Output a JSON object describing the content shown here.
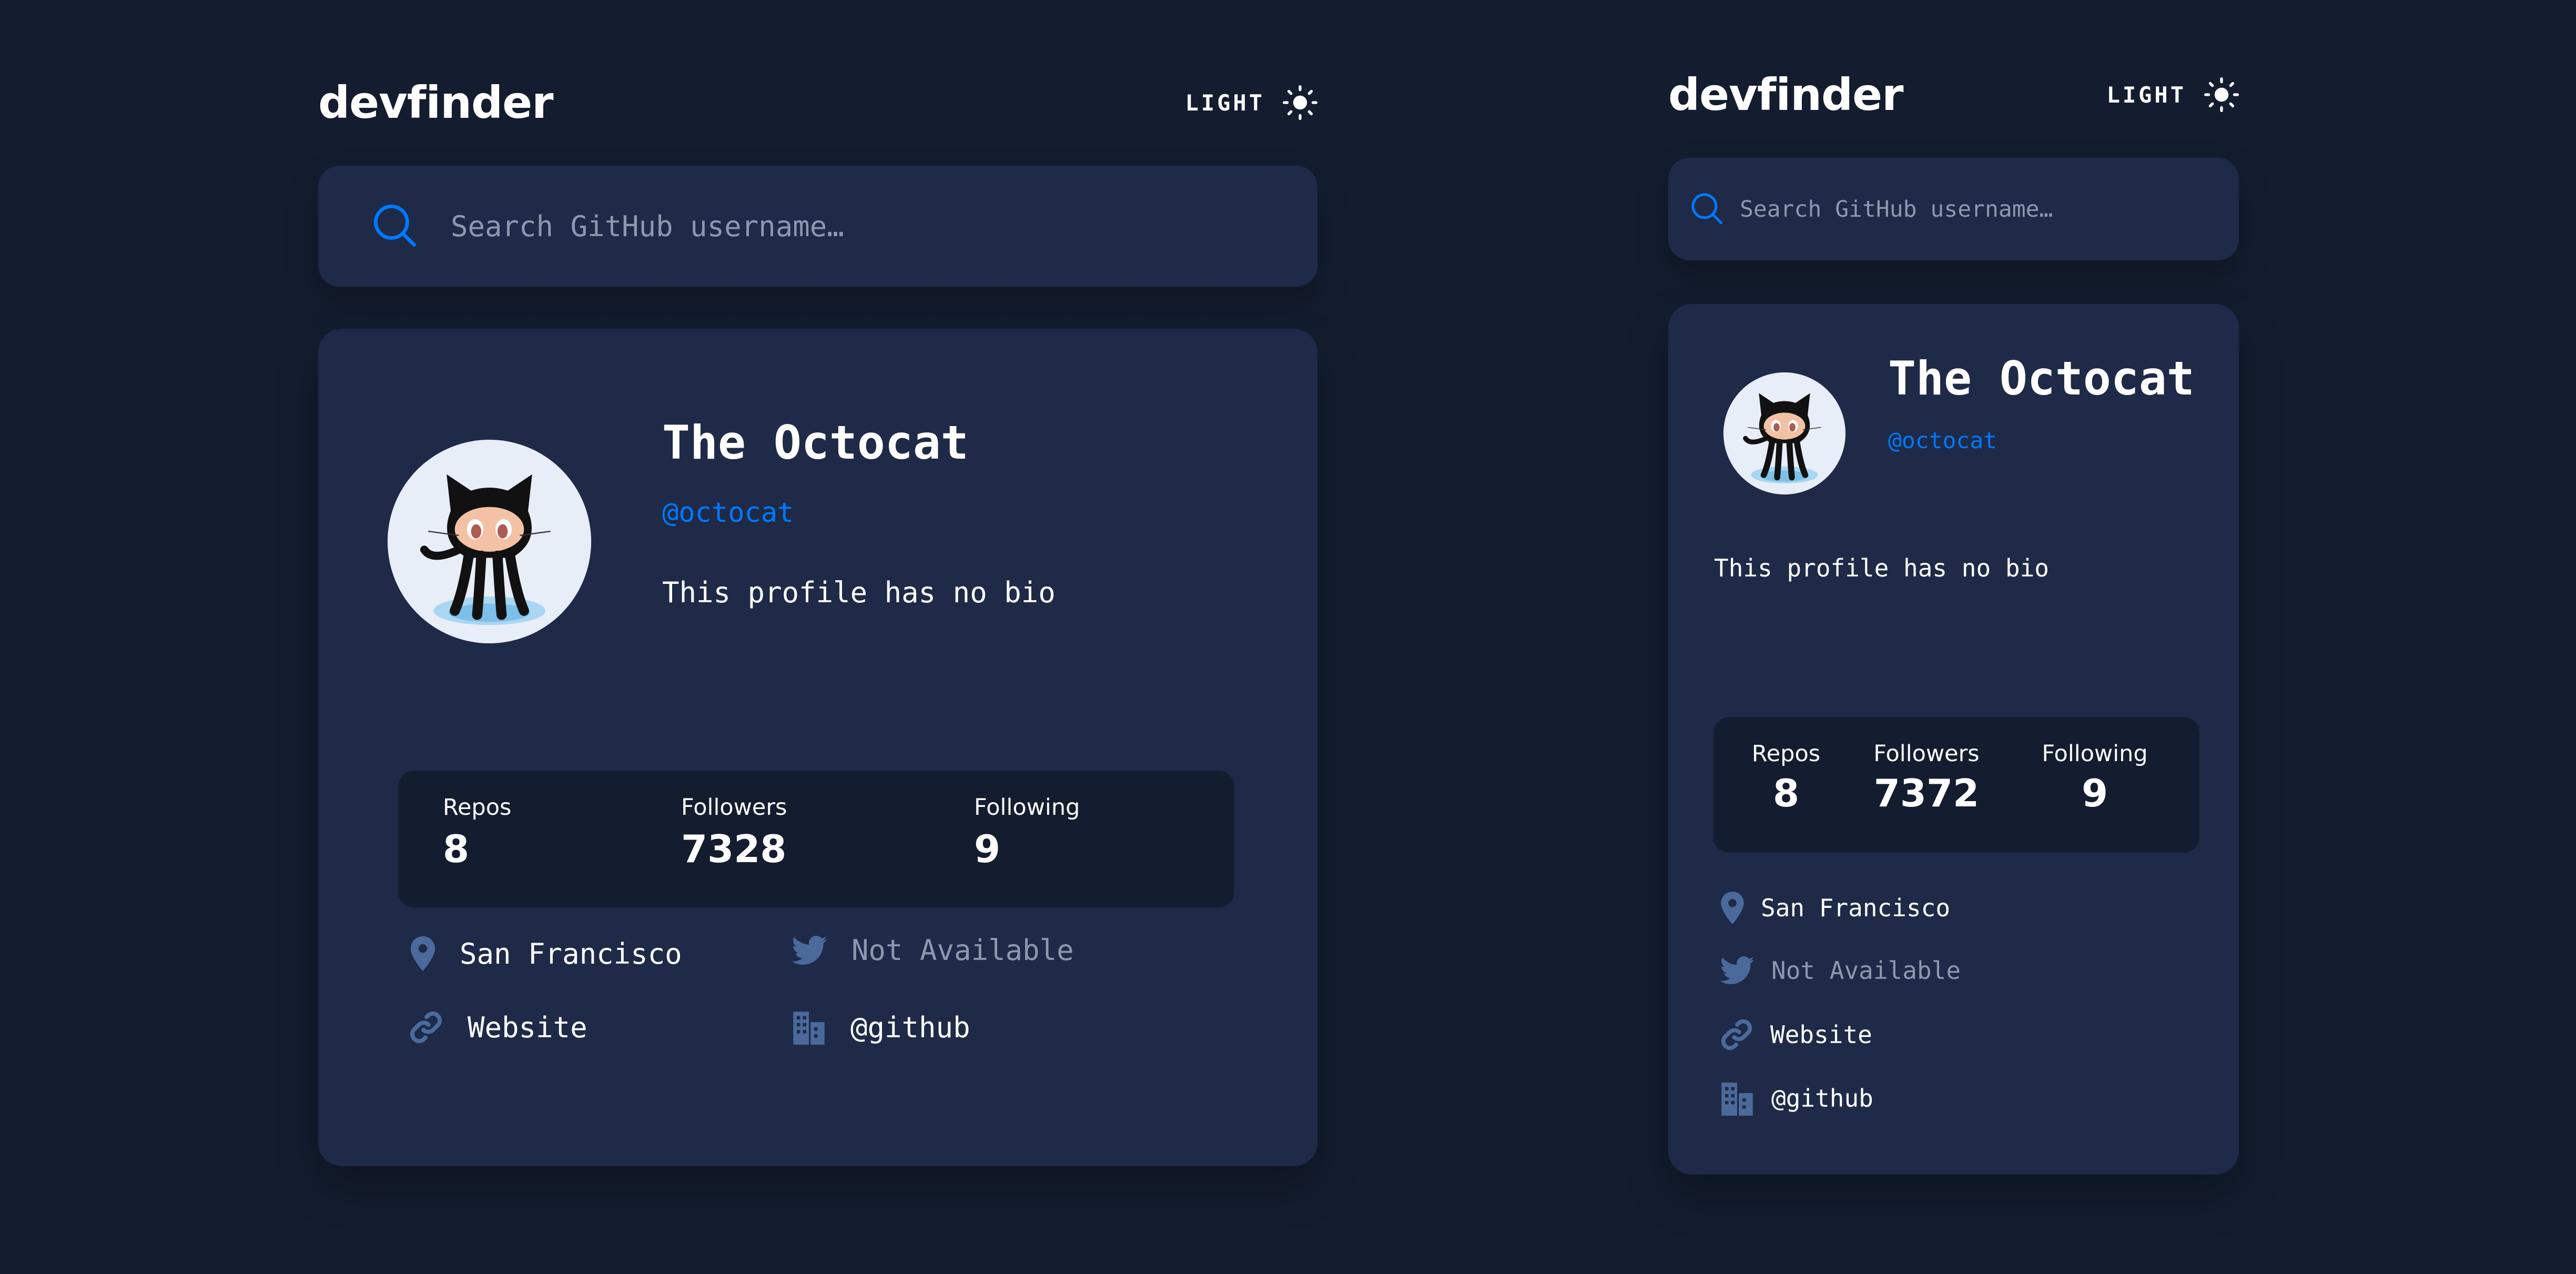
{
  "colors": {
    "background": "#141d2f",
    "card": "#1e2a47",
    "accent": "#0079ff",
    "icon": "#4b6a9b",
    "muted": "#8d98ad",
    "text": "#ffffff"
  },
  "desktop": {
    "header": {
      "logo": "devfinder",
      "theme_label": "LIGHT",
      "theme_icon": "sun-icon"
    },
    "search": {
      "placeholder": "Search GitHub username…",
      "icon": "search-icon"
    },
    "profile": {
      "name": "The Octocat",
      "login": "@octocat",
      "bio": "This profile has no bio",
      "stats": [
        {
          "label": "Repos",
          "value": "8"
        },
        {
          "label": "Followers",
          "value": "7328"
        },
        {
          "label": "Following",
          "value": "9"
        }
      ],
      "links": [
        {
          "icon": "location-icon",
          "text": "San Francisco"
        },
        {
          "icon": "twitter-icon",
          "text": "Not Available"
        },
        {
          "icon": "link-icon",
          "text": "Website"
        },
        {
          "icon": "company-icon",
          "text": "@github"
        }
      ]
    }
  },
  "tablet": {
    "header": {
      "logo": "devfinder",
      "theme_label": "LIGHT",
      "theme_icon": "sun-icon"
    },
    "search": {
      "placeholder": "Search GitHub username…",
      "icon": "search-icon"
    },
    "profile": {
      "name": "The Octocat",
      "login": "@octocat",
      "bio": "This profile has no bio",
      "stats": [
        {
          "label": "Repos",
          "value": "8"
        },
        {
          "label": "Followers",
          "value": "7372"
        },
        {
          "label": "Following",
          "value": "9"
        }
      ],
      "links": [
        {
          "icon": "location-icon",
          "text": "San Francisco"
        },
        {
          "icon": "twitter-icon",
          "text": "Not Available"
        },
        {
          "icon": "link-icon",
          "text": "Website"
        },
        {
          "icon": "company-icon",
          "text": "@github"
        }
      ]
    }
  }
}
